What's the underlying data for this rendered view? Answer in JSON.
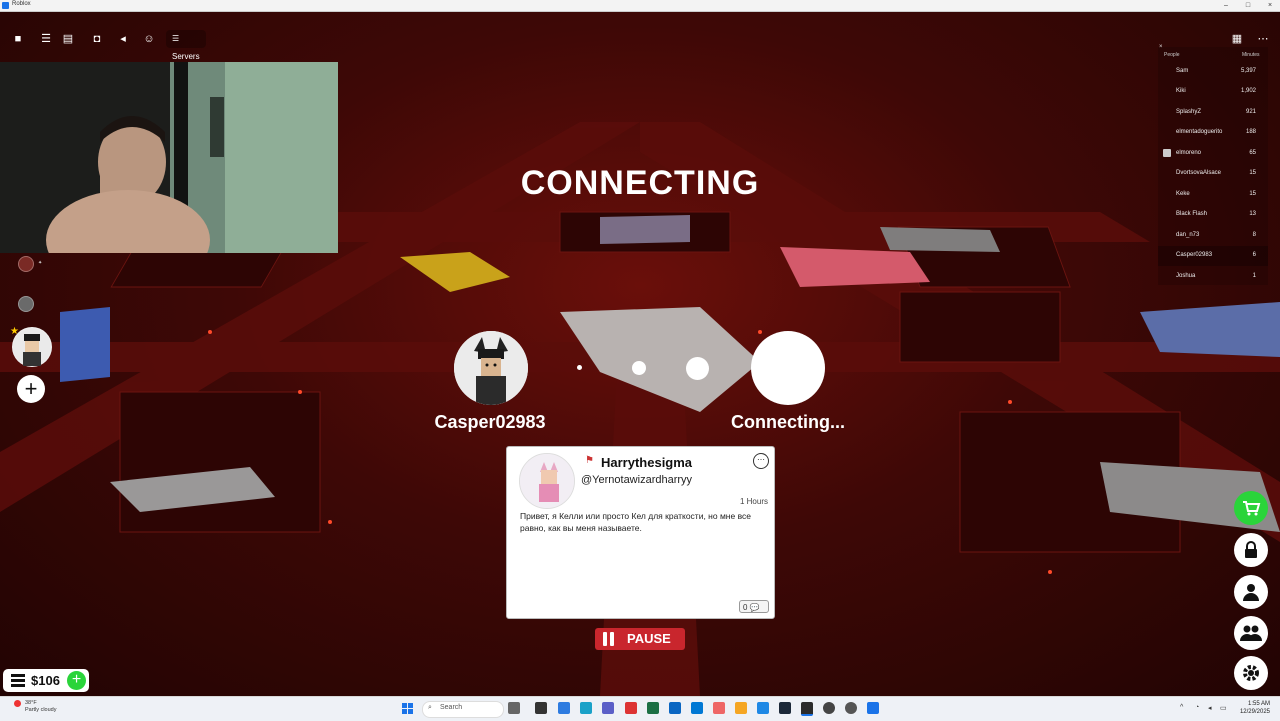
{
  "window": {
    "title": "Roblox"
  },
  "topbar": {
    "servers_label": "Servers"
  },
  "status": {
    "title": "CONNECTING"
  },
  "players": {
    "left_name": "Casper02983",
    "right_name": "Connecting..."
  },
  "profile_card": {
    "name": "Harrythesigma",
    "handle": "@Yernotawizardharryy",
    "time": "1 Hours",
    "message": "Привет, я Келли или просто Кел для краткости, но мне все равно, как вы меня называете.",
    "reply_count": "0"
  },
  "pause": {
    "label": "PAUSE"
  },
  "leaderboard": {
    "col_people": "People",
    "col_minutes": "Minutes",
    "rows": [
      {
        "name": "Sam",
        "minutes": "5,397"
      },
      {
        "name": "Kiki",
        "minutes": "1,902"
      },
      {
        "name": "SplashyZ",
        "minutes": "921"
      },
      {
        "name": "elmentadoguerito",
        "minutes": "188"
      },
      {
        "name": "elmoreno",
        "minutes": "65"
      },
      {
        "name": "DvortsovaAlsace",
        "minutes": "15"
      },
      {
        "name": "Keke",
        "minutes": "15"
      },
      {
        "name": "Black Flash",
        "minutes": "13"
      },
      {
        "name": "dan_n73",
        "minutes": "8"
      },
      {
        "name": "Casper02983",
        "minutes": "6"
      },
      {
        "name": "Joshua",
        "minutes": "1"
      }
    ]
  },
  "wallet": {
    "amount": "$106"
  },
  "taskbar": {
    "weather_temp": "38°F",
    "weather_text": "Partly cloudy",
    "search_placeholder": "Search",
    "time": "1:55 AM",
    "date": "12/29/2025"
  },
  "colors": {
    "accent_red": "#c9262d",
    "cart_green": "#2ad43a",
    "bg_dark_red": "#3e0806"
  }
}
